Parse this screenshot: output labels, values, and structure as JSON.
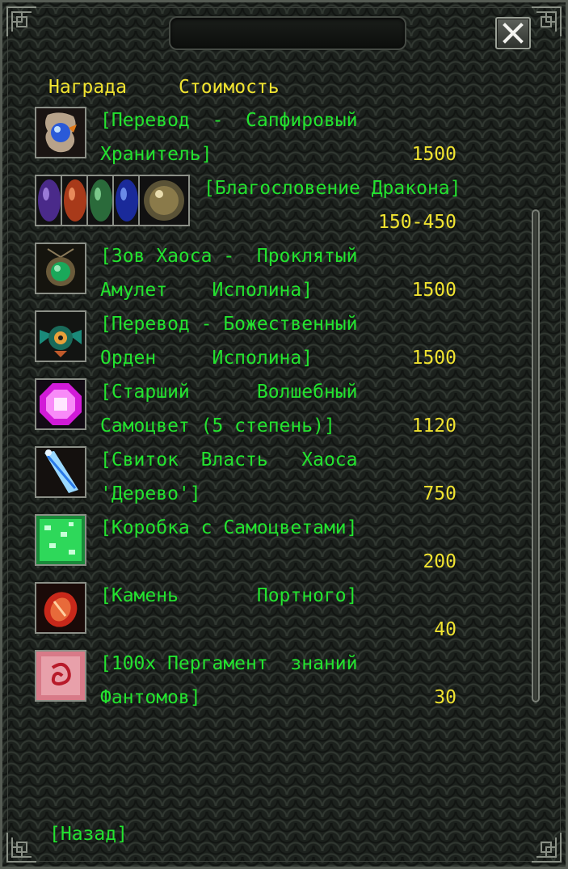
{
  "header": {
    "reward_label": "Награда",
    "cost_label": "Стоимость"
  },
  "close_icon": "close-x-icon",
  "items": [
    {
      "icon": "sapphire-guardian-icon",
      "lines": [
        "[Перевод  -  Сапфировый",
        "Хранитель]"
      ],
      "price": "1500"
    },
    {
      "icon": "dragon-orbs-icon",
      "lines": [
        "[Благословение Дракона]"
      ],
      "price": "150-450"
    },
    {
      "icon": "cursed-amulet-icon",
      "lines": [
        "[Зов Хаоса -  Проклятый",
        "Амулет    Исполина]"
      ],
      "price": "1500"
    },
    {
      "icon": "divine-order-icon",
      "lines": [
        "[Перевод - Божественный",
        "Орден     Исполина]"
      ],
      "price": "1500"
    },
    {
      "icon": "magic-gem-icon",
      "lines": [
        "[Старший      Волшебный",
        "Самоцвет (5 степень)]"
      ],
      "price": "1120"
    },
    {
      "icon": "chaos-scroll-icon",
      "lines": [
        "[Свиток  Власть   Хаоса",
        "'Дерево']"
      ],
      "price": "750"
    },
    {
      "icon": "gem-box-icon",
      "lines": [
        "[Коробка с Самоцветами]"
      ],
      "price": "200"
    },
    {
      "icon": "tailor-stone-icon",
      "lines": [
        "[Камень       Портного]"
      ],
      "price": "40"
    },
    {
      "icon": "phantom-parchment-icon",
      "lines": [
        "[100x Пергамент  знаний",
        "Фантомов]"
      ],
      "price": "30"
    }
  ],
  "footer": {
    "back_label": "[Назад]"
  },
  "colors": {
    "name_green": "#23e32f",
    "price_yellow": "#f0e330",
    "frame": "#565c54"
  }
}
